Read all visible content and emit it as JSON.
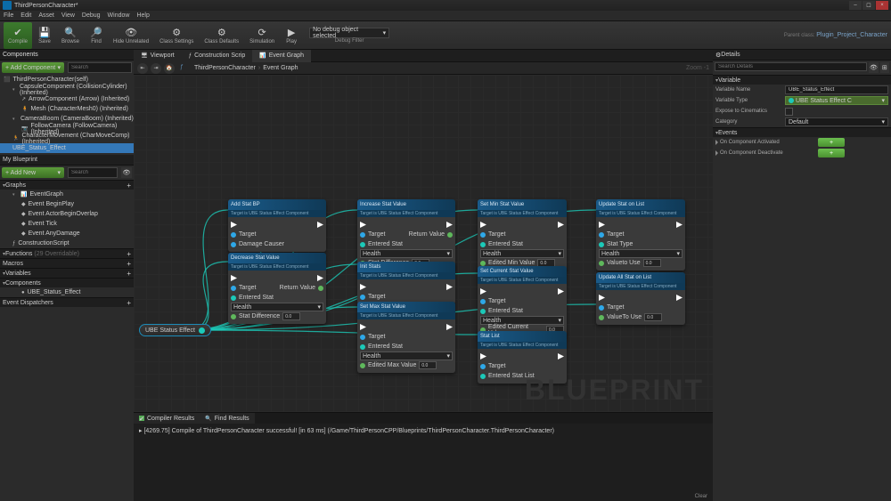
{
  "title": "ThirdPersonCharacter*",
  "parent_class": "Plugin_Project_Character",
  "menu": [
    "File",
    "Edit",
    "Asset",
    "View",
    "Debug",
    "Window",
    "Help"
  ],
  "toolbar": {
    "compile": "Compile",
    "save": "Save",
    "browse": "Browse",
    "find": "Find",
    "hide": "Hide Unrelated",
    "settings": "Class Settings",
    "defaults": "Class Defaults",
    "simulation": "Simulation",
    "play": "Play",
    "debug_selected": "No debug object selected",
    "debug_label": "Debug Filter"
  },
  "components": {
    "add": "+ Add Component",
    "search_placeholder": "Search",
    "root": "ThirdPersonCharacter(self)",
    "items": [
      "CapsuleComponent (CollisionCylinder) (Inherited)",
      "ArrowComponent (Arrow) (Inherited)",
      "Mesh (CharacterMesh0) (Inherited)",
      "CameraBoom (CameraBoom) (Inherited)",
      "FollowCamera (FollowCamera) (Inherited)",
      "CharacterMovement (CharMoveComp) (Inherited)",
      "UBE_Status_Effect"
    ]
  },
  "myblueprint": {
    "title": "My Blueprint",
    "add": "+ Add New",
    "search_placeholder": "Search",
    "graphs": "Graphs",
    "eventgraph": "EventGraph",
    "events": [
      "Event BeginPlay",
      "Event ActorBeginOverlap",
      "Event Tick",
      "Event AnyDamage"
    ],
    "construction": "ConstructionScript",
    "functions": "Functions",
    "functions_count": "(29 Overridable)",
    "macros": "Macros",
    "variables": "Variables",
    "var1": "UBE_Status_Effect",
    "components_cat": "Components",
    "dispatchers": "Event Dispatchers"
  },
  "tabs": {
    "viewport": "Viewport",
    "construction": "Construction Scrip",
    "eventgraph": "Event Graph"
  },
  "breadcrumb": {
    "a": "ThirdPersonCharacter",
    "b": "Event Graph",
    "zoom": "Zoom -1"
  },
  "watermark": "BLUEPRINT",
  "capsule": "UBE Status Effect",
  "nodes": {
    "sub": "Target is UBE Status Effect Component",
    "target": "Target",
    "return": "Return Value",
    "add": {
      "t": "Add Stat BP",
      "p1": "Damage Causer"
    },
    "decrease": {
      "t": "Decrease Stat Value",
      "p1": "Entered Stat",
      "p2": "Stat Difference",
      "c": "Health",
      "v": "0.0"
    },
    "increase": {
      "t": "Increase Stat Value",
      "p1": "Entered Stat",
      "p2": "Stat Difference",
      "c": "Health",
      "v": "0.0"
    },
    "init": {
      "t": "Init Stats"
    },
    "setmax": {
      "t": "Set Max Stat Value",
      "p1": "Entered Stat",
      "p2": "Edited Max Value",
      "c": "Health",
      "v": "0.0"
    },
    "setmin": {
      "t": "Set Min Stat Value",
      "p1": "Entered Stat",
      "p2": "Edited Min Value",
      "c": "Health",
      "v": "0.0"
    },
    "setcur": {
      "t": "Set Current Stat Value",
      "p1": "Entered Stat",
      "p2": "Edited Current Value",
      "c": "Health",
      "v": "0.0"
    },
    "statlist": {
      "t": "Stat List",
      "p1": "Entered Stat List"
    },
    "updone": {
      "t": "Update Stat on List",
      "p1": "Stat Type",
      "p2": "Valueto Use",
      "c": "Health",
      "v": "0.0"
    },
    "updall": {
      "t": "Update All Stat on List",
      "p1": "ValueTo Use",
      "v": "0.0"
    }
  },
  "compiler": {
    "tab1": "Compiler Results",
    "tab2": "Find Results",
    "msg": "[4269.75] Compile of ThirdPersonCharacter successful! [in 63 ms] (/Game/ThirdPersonCPP/Blueprints/ThirdPersonCharacter.ThirdPersonCharacter)",
    "clear": "Clear"
  },
  "details": {
    "title": "Details",
    "search_placeholder": "Search Details",
    "variable": "Variable",
    "name_k": "Variable Name",
    "name_v": "UBE_Status_Effect",
    "type_k": "Variable Type",
    "type_v": "UBE Status Effect C",
    "expose_k": "Expose to Cinematics",
    "category_k": "Category",
    "category_v": "Default",
    "events": "Events",
    "evt1": "On Component Activated",
    "evt2": "On Component Deactivate"
  }
}
